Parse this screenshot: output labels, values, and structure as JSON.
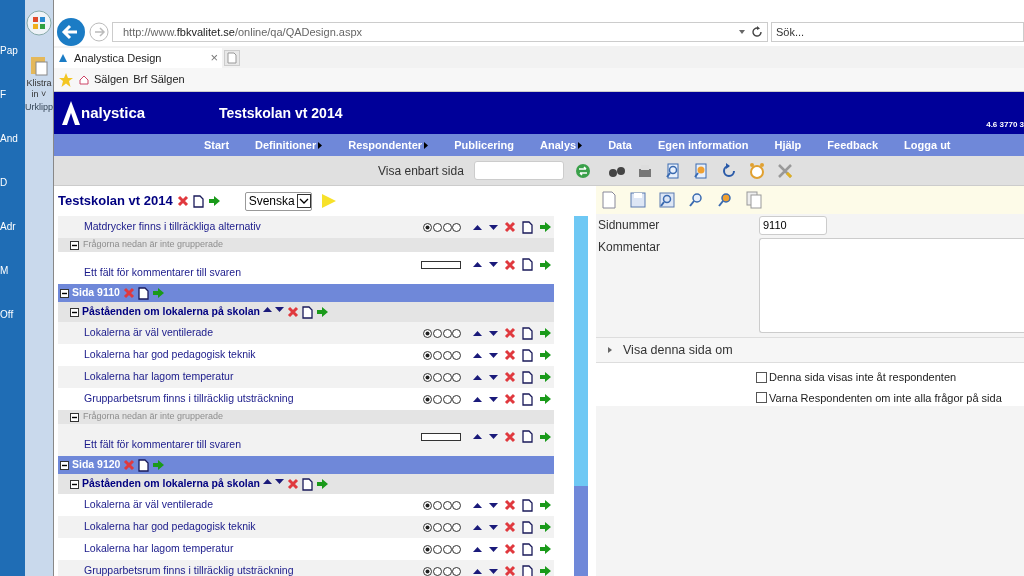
{
  "desktop": {
    "labels": [
      "Pap",
      "F",
      "And",
      "D",
      "Adr",
      "M",
      "Off"
    ]
  },
  "ribbon": {
    "paste_label": "Klistra",
    "paste_sub": "in ˅",
    "group": "Urklipp"
  },
  "browser": {
    "url_prefix": "http://www.",
    "url_host": "fbkvalitet.se",
    "url_path": "/online/qa/QADesign.aspx",
    "search_placeholder": "Sök...",
    "tab": {
      "title": "Analystica Design",
      "close": "×"
    },
    "favorites": [
      "Sälgen",
      "Brf Sälgen"
    ]
  },
  "app": {
    "logo": "nalystica",
    "title": "Testskolan vt 2014",
    "version": "4.6 3770 3",
    "menu": [
      {
        "label": "Start",
        "submenu": false
      },
      {
        "label": "Definitioner",
        "submenu": true
      },
      {
        "label": "Respondenter",
        "submenu": true
      },
      {
        "label": "Publicering",
        "submenu": false
      },
      {
        "label": "Analys",
        "submenu": true
      },
      {
        "label": "Data",
        "submenu": false
      },
      {
        "label": "Egen information",
        "submenu": false
      },
      {
        "label": "Hjälp",
        "submenu": false
      },
      {
        "label": "Feedback",
        "submenu": false
      },
      {
        "label": "Logga ut",
        "submenu": false
      }
    ],
    "filter_label": "Visa enbart sida"
  },
  "survey": {
    "title": "Testskolan vt 2014",
    "language": "Svenska",
    "rows": [
      {
        "kind": "radio_question",
        "text": "Matdrycker finns i tillräckliga alternativ"
      },
      {
        "kind": "info",
        "text": "Frågorna nedan är inte grupperade"
      },
      {
        "kind": "text_question",
        "text": "Ett fält för kommentarer till svaren"
      },
      {
        "kind": "page",
        "text": "Sida 9110"
      },
      {
        "kind": "group",
        "text": "Påståenden om lokalerna på skolan"
      },
      {
        "kind": "radio_question",
        "text": "Lokalerna är väl ventilerade"
      },
      {
        "kind": "radio_question",
        "text": "Lokalerna har god pedagogisk teknik"
      },
      {
        "kind": "radio_question",
        "text": "Lokalerna har lagom temperatur"
      },
      {
        "kind": "radio_question",
        "text": "Grupparbetsrum finns i tillräcklig utsträckning"
      },
      {
        "kind": "info",
        "text": "Frågorna nedan är inte grupperade"
      },
      {
        "kind": "text_question",
        "text": "Ett fält för kommentarer till svaren"
      },
      {
        "kind": "page",
        "text": "Sida 9120"
      },
      {
        "kind": "group",
        "text": "Påståenden om lokalerna på skolan"
      },
      {
        "kind": "radio_question",
        "text": "Lokalerna är väl ventilerade"
      },
      {
        "kind": "radio_question",
        "text": "Lokalerna har god pedagogisk teknik"
      },
      {
        "kind": "radio_question",
        "text": "Lokalerna har lagom temperatur"
      },
      {
        "kind": "radio_question",
        "text": "Grupparbetsrum finns i tillräcklig utsträckning"
      }
    ]
  },
  "page_form": {
    "number_label": "Sidnummer",
    "number": "9110",
    "comment_label": "Kommentar",
    "condition": {
      "label": "Visa denna sida om",
      "expanded": false
    },
    "options": [
      {
        "label": "Denna sida visas inte åt respondenten",
        "checked": false
      },
      {
        "label": "Varna Respondenten om inte alla frågor på sida",
        "checked": false
      }
    ]
  }
}
